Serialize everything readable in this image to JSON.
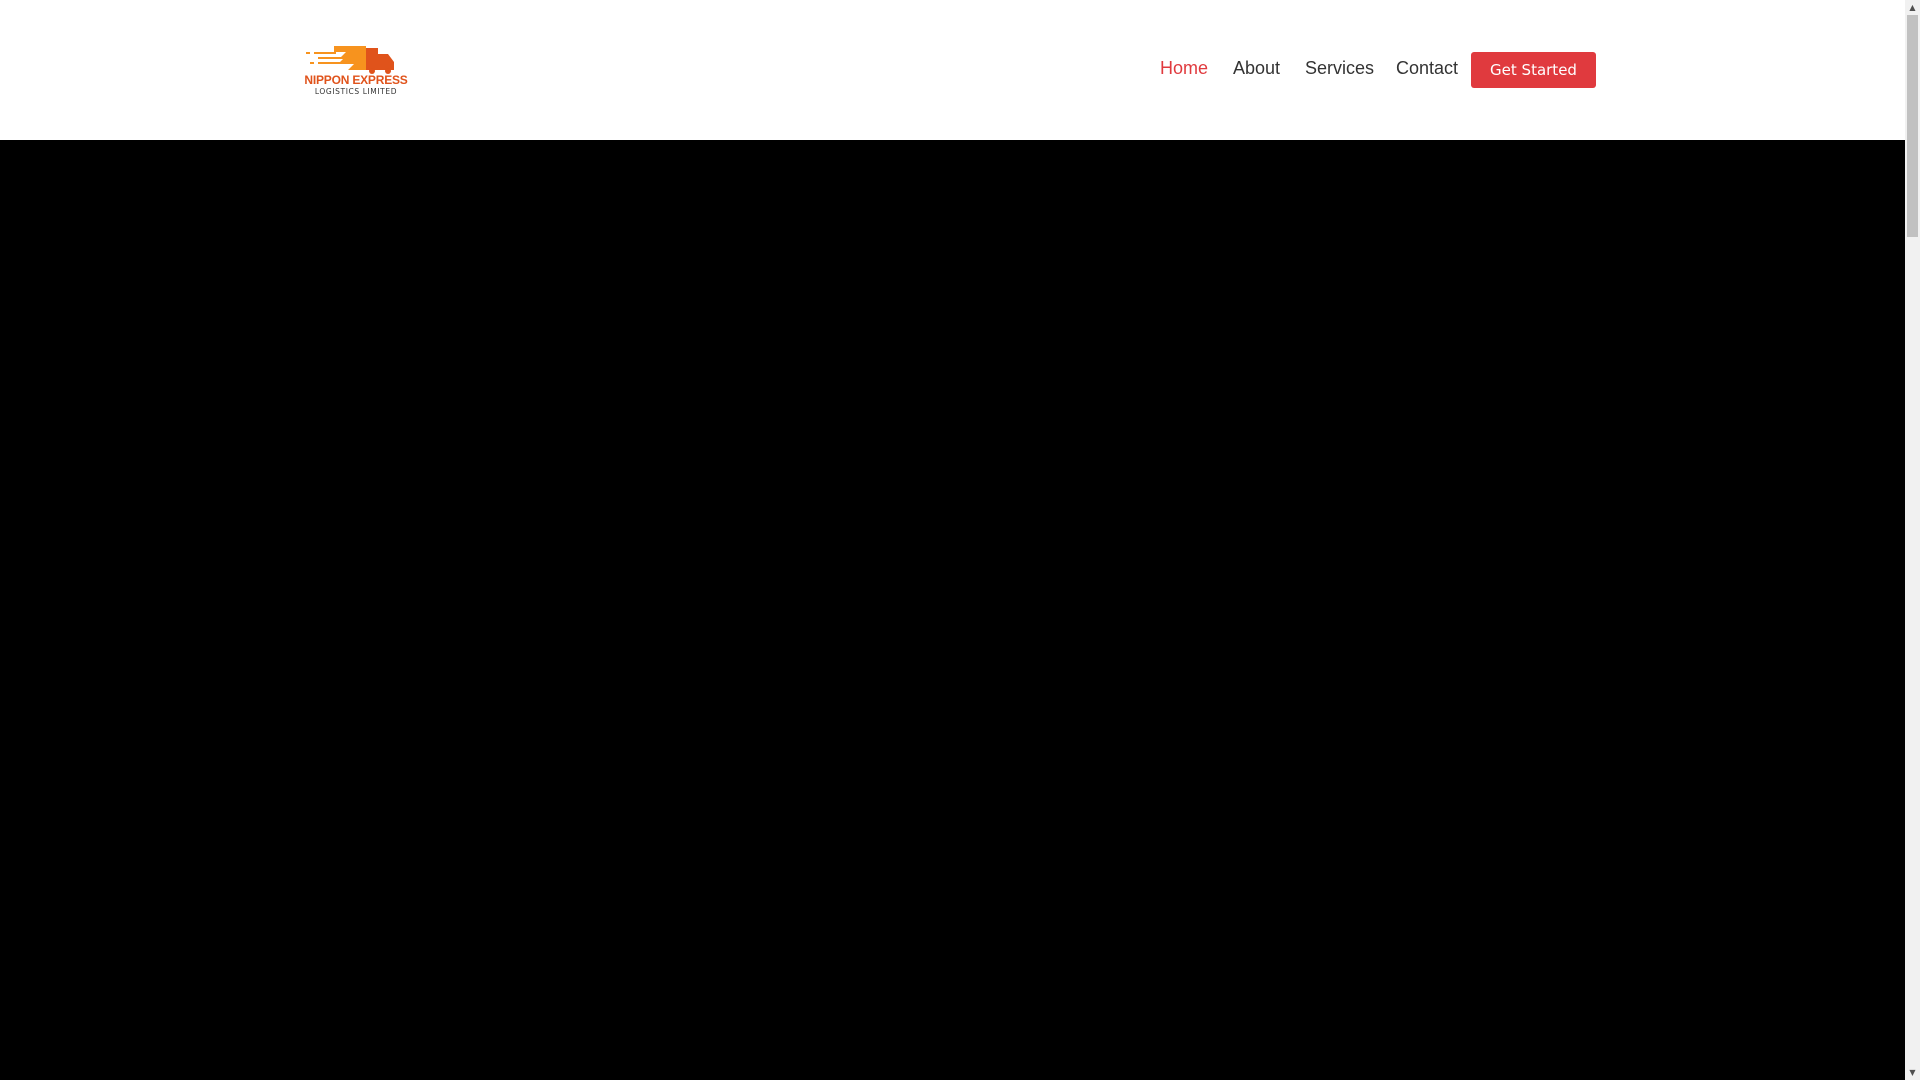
{
  "logo": {
    "line1": "NIPPON EXPRESS",
    "line2": "LOGISTICS LIMITED"
  },
  "nav": [
    {
      "label": "Home",
      "active": true
    },
    {
      "label": "About"
    },
    {
      "label": "Services"
    },
    {
      "label": "Contact"
    }
  ],
  "cta": {
    "label": "Get Started"
  },
  "scrollbar": {
    "up": "▲",
    "down": "▼"
  },
  "colors": {
    "accent": "#e03a3e",
    "logo_orange": "#f7931e",
    "logo_dark_orange": "#e0531b"
  }
}
